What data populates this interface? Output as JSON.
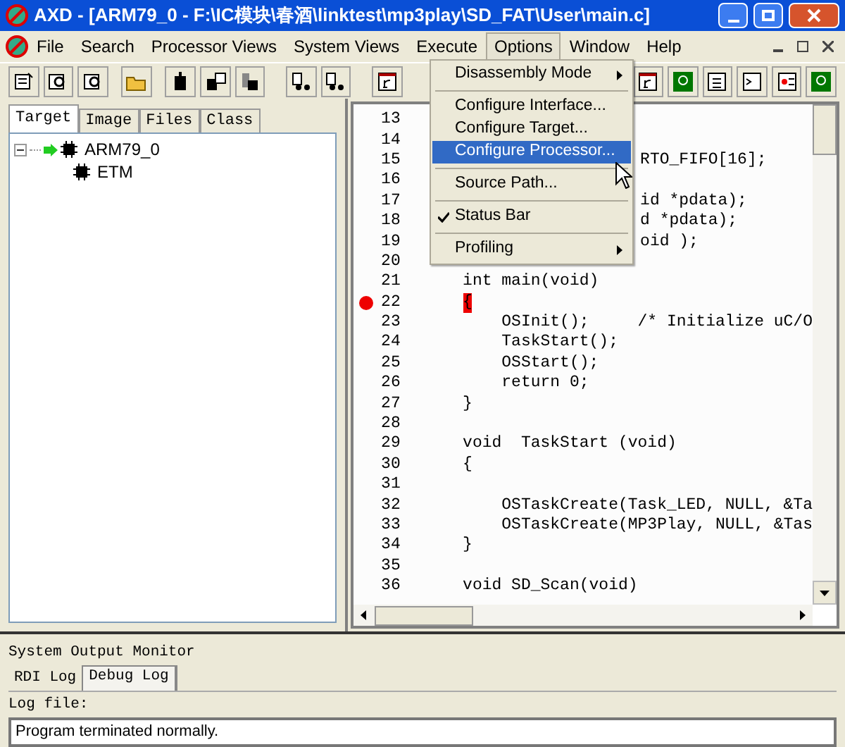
{
  "window": {
    "title": "AXD - [ARM79_0 - F:\\IC模块\\春酒\\linktest\\mp3play\\SD_FAT\\User\\main.c]"
  },
  "menu": [
    {
      "label": "File",
      "selected": false
    },
    {
      "label": "Search",
      "selected": false
    },
    {
      "label": "Processor Views",
      "selected": false
    },
    {
      "label": "System Views",
      "selected": false
    },
    {
      "label": "Execute",
      "selected": false
    },
    {
      "label": "Options",
      "selected": true
    },
    {
      "label": "Window",
      "selected": false
    },
    {
      "label": "Help",
      "selected": false
    }
  ],
  "options_menu": [
    {
      "kind": "submenu",
      "label": "Disassembly Mode",
      "selected": false,
      "checked": false
    },
    {
      "kind": "separator"
    },
    {
      "kind": "item",
      "label": "Configure Interface...",
      "selected": false,
      "checked": false
    },
    {
      "kind": "item",
      "label": "Configure Target...",
      "selected": false,
      "checked": false
    },
    {
      "kind": "item",
      "label": "Configure Processor...",
      "selected": true,
      "checked": false
    },
    {
      "kind": "separator"
    },
    {
      "kind": "item",
      "label": "Source Path...",
      "selected": false,
      "checked": false
    },
    {
      "kind": "separator"
    },
    {
      "kind": "item",
      "label": "Status Bar",
      "selected": false,
      "checked": true
    },
    {
      "kind": "separator"
    },
    {
      "kind": "submenu",
      "label": "Profiling",
      "selected": false,
      "checked": false
    }
  ],
  "left_panel": {
    "tabs": [
      {
        "label": "Target",
        "selected": true
      },
      {
        "label": "Image",
        "selected": false
      },
      {
        "label": "Files",
        "selected": false
      },
      {
        "label": "Class",
        "selected": false
      }
    ],
    "tree": [
      {
        "label": "ARM79_0",
        "expanded": true,
        "current": true,
        "children": [
          {
            "label": "ETM",
            "current": false
          }
        ]
      }
    ]
  },
  "editor": {
    "lines": [
      {
        "number": "13",
        "breakpoint": false,
        "current": false
      },
      {
        "number": "14",
        "breakpoint": false,
        "current": false
      },
      {
        "number": "15",
        "visible_tail": "RTO_FIFO[16];",
        "breakpoint": false,
        "current": false
      },
      {
        "number": "16",
        "breakpoint": false,
        "current": false
      },
      {
        "number": "17",
        "visible_tail": "id *pdata);",
        "breakpoint": false,
        "current": false
      },
      {
        "number": "18",
        "visible_tail": "d *pdata);",
        "breakpoint": false,
        "current": false
      },
      {
        "number": "19",
        "visible_tail": "oid );",
        "breakpoint": false,
        "current": false
      },
      {
        "number": "20",
        "breakpoint": false,
        "current": false
      },
      {
        "number": "21",
        "code": "int main(void)",
        "breakpoint": false,
        "current": false
      },
      {
        "number": "22",
        "code": "{",
        "breakpoint": true,
        "current": true
      },
      {
        "number": "23",
        "code": "    OSInit();     /* Initialize uC/O",
        "breakpoint": false,
        "current": false
      },
      {
        "number": "24",
        "code": "    TaskStart();",
        "breakpoint": false,
        "current": false
      },
      {
        "number": "25",
        "code": "    OSStart();",
        "breakpoint": false,
        "current": false
      },
      {
        "number": "26",
        "code": "    return 0;",
        "breakpoint": false,
        "current": false
      },
      {
        "number": "27",
        "code": "}",
        "breakpoint": false,
        "current": false
      },
      {
        "number": "28",
        "breakpoint": false,
        "current": false
      },
      {
        "number": "29",
        "code": "void  TaskStart (void)",
        "breakpoint": false,
        "current": false
      },
      {
        "number": "30",
        "code": "{",
        "breakpoint": false,
        "current": false
      },
      {
        "number": "31",
        "breakpoint": false,
        "current": false
      },
      {
        "number": "32",
        "code": "    OSTaskCreate(Task_LED, NULL, &Ta",
        "breakpoint": false,
        "current": false
      },
      {
        "number": "33",
        "code": "    OSTaskCreate(MP3Play, NULL, &Tas",
        "breakpoint": false,
        "current": false
      },
      {
        "number": "34",
        "code": "}",
        "breakpoint": false,
        "current": false
      },
      {
        "number": "35",
        "breakpoint": false,
        "current": false
      },
      {
        "number": "36",
        "code": "void SD_Scan(void)",
        "breakpoint": false,
        "current": false
      }
    ]
  },
  "output_monitor": {
    "title": "System Output Monitor",
    "tabs": [
      {
        "label": "RDI Log",
        "selected": false
      },
      {
        "label": "Debug Log",
        "selected": true
      }
    ],
    "log_label": "Log file:",
    "log_text": "Program terminated normally."
  }
}
